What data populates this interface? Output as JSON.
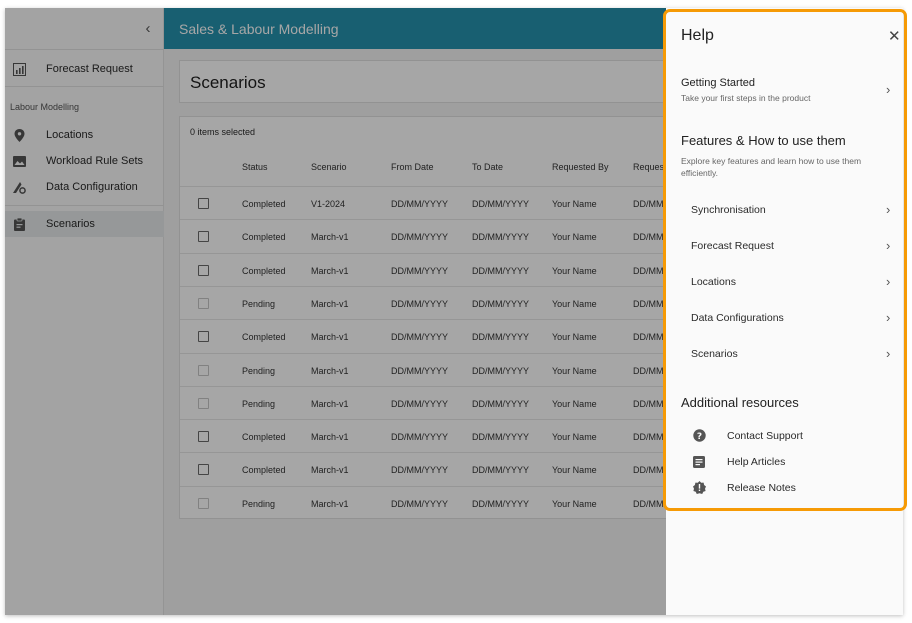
{
  "topbar": {
    "title": "Sales & Labour Modelling"
  },
  "sidebar": {
    "collapse_icon": "chevron-left-icon",
    "forecast": {
      "label": "Forecast Request",
      "icon": "chart-icon"
    },
    "section_label": "Labour Modelling",
    "items": [
      {
        "label": "Locations",
        "icon": "location-pin-icon"
      },
      {
        "label": "Workload Rule Sets",
        "icon": "image-chart-icon"
      },
      {
        "label": "Data Configuration",
        "icon": "config-icon"
      }
    ],
    "scenarios": {
      "label": "Scenarios",
      "icon": "clipboard-icon"
    }
  },
  "page": {
    "title": "Scenarios"
  },
  "table": {
    "selected_text": "0 items selected",
    "headers": [
      "Status",
      "Scenario",
      "From Date",
      "To Date",
      "Requested By",
      "Request"
    ],
    "rows": [
      {
        "status": "Completed",
        "scenario": "V1-2024",
        "from": "DD/MM/YYYY",
        "to": "DD/MM/YYYY",
        "by": "Your Name",
        "req": "DD/MM/",
        "enabled": true
      },
      {
        "status": "Completed",
        "scenario": "March-v1",
        "from": "DD/MM/YYYY",
        "to": "DD/MM/YYYY",
        "by": "Your Name",
        "req": "DD/MM/",
        "enabled": true
      },
      {
        "status": "Completed",
        "scenario": "March-v1",
        "from": "DD/MM/YYYY",
        "to": "DD/MM/YYYY",
        "by": "Your Name",
        "req": "DD/MM/",
        "enabled": true
      },
      {
        "status": "Pending",
        "scenario": "March-v1",
        "from": "DD/MM/YYYY",
        "to": "DD/MM/YYYY",
        "by": "Your Name",
        "req": "DD/MM/",
        "enabled": false
      },
      {
        "status": "Completed",
        "scenario": "March-v1",
        "from": "DD/MM/YYYY",
        "to": "DD/MM/YYYY",
        "by": "Your Name",
        "req": "DD/MM/",
        "enabled": true
      },
      {
        "status": "Pending",
        "scenario": "March-v1",
        "from": "DD/MM/YYYY",
        "to": "DD/MM/YYYY",
        "by": "Your Name",
        "req": "DD/MM/",
        "enabled": false
      },
      {
        "status": "Pending",
        "scenario": "March-v1",
        "from": "DD/MM/YYYY",
        "to": "DD/MM/YYYY",
        "by": "Your Name",
        "req": "DD/MM/",
        "enabled": false
      },
      {
        "status": "Completed",
        "scenario": "March-v1",
        "from": "DD/MM/YYYY",
        "to": "DD/MM/YYYY",
        "by": "Your Name",
        "req": "DD/MM/",
        "enabled": true
      },
      {
        "status": "Completed",
        "scenario": "March-v1",
        "from": "DD/MM/YYYY",
        "to": "DD/MM/YYYY",
        "by": "Your Name",
        "req": "DD/MM/",
        "enabled": true
      },
      {
        "status": "Pending",
        "scenario": "March-v1",
        "from": "DD/MM/YYYY",
        "to": "DD/MM/YYYY",
        "by": "Your Name",
        "req": "DD/MM/",
        "enabled": false
      }
    ]
  },
  "help": {
    "title": "Help",
    "close_icon": "close-icon",
    "getting_started": {
      "title": "Getting Started",
      "subtitle": "Take your first steps in the product"
    },
    "features_title": "Features & How to use them",
    "features_desc": "Explore key features and learn how to use them efficiently.",
    "features": [
      "Synchronisation",
      "Forecast Request",
      "Locations",
      "Data Configurations",
      "Scenarios"
    ],
    "resources_title": "Additional resources",
    "resources": [
      {
        "label": "Contact Support",
        "icon": "help-circle-icon"
      },
      {
        "label": "Help Articles",
        "icon": "article-icon"
      },
      {
        "label": "Release Notes",
        "icon": "alert-badge-icon"
      }
    ],
    "highlight_color": "#f69a05"
  },
  "colors": {
    "topbar": "#2592ae",
    "overlay": "rgba(0,0,0,0.35)"
  }
}
